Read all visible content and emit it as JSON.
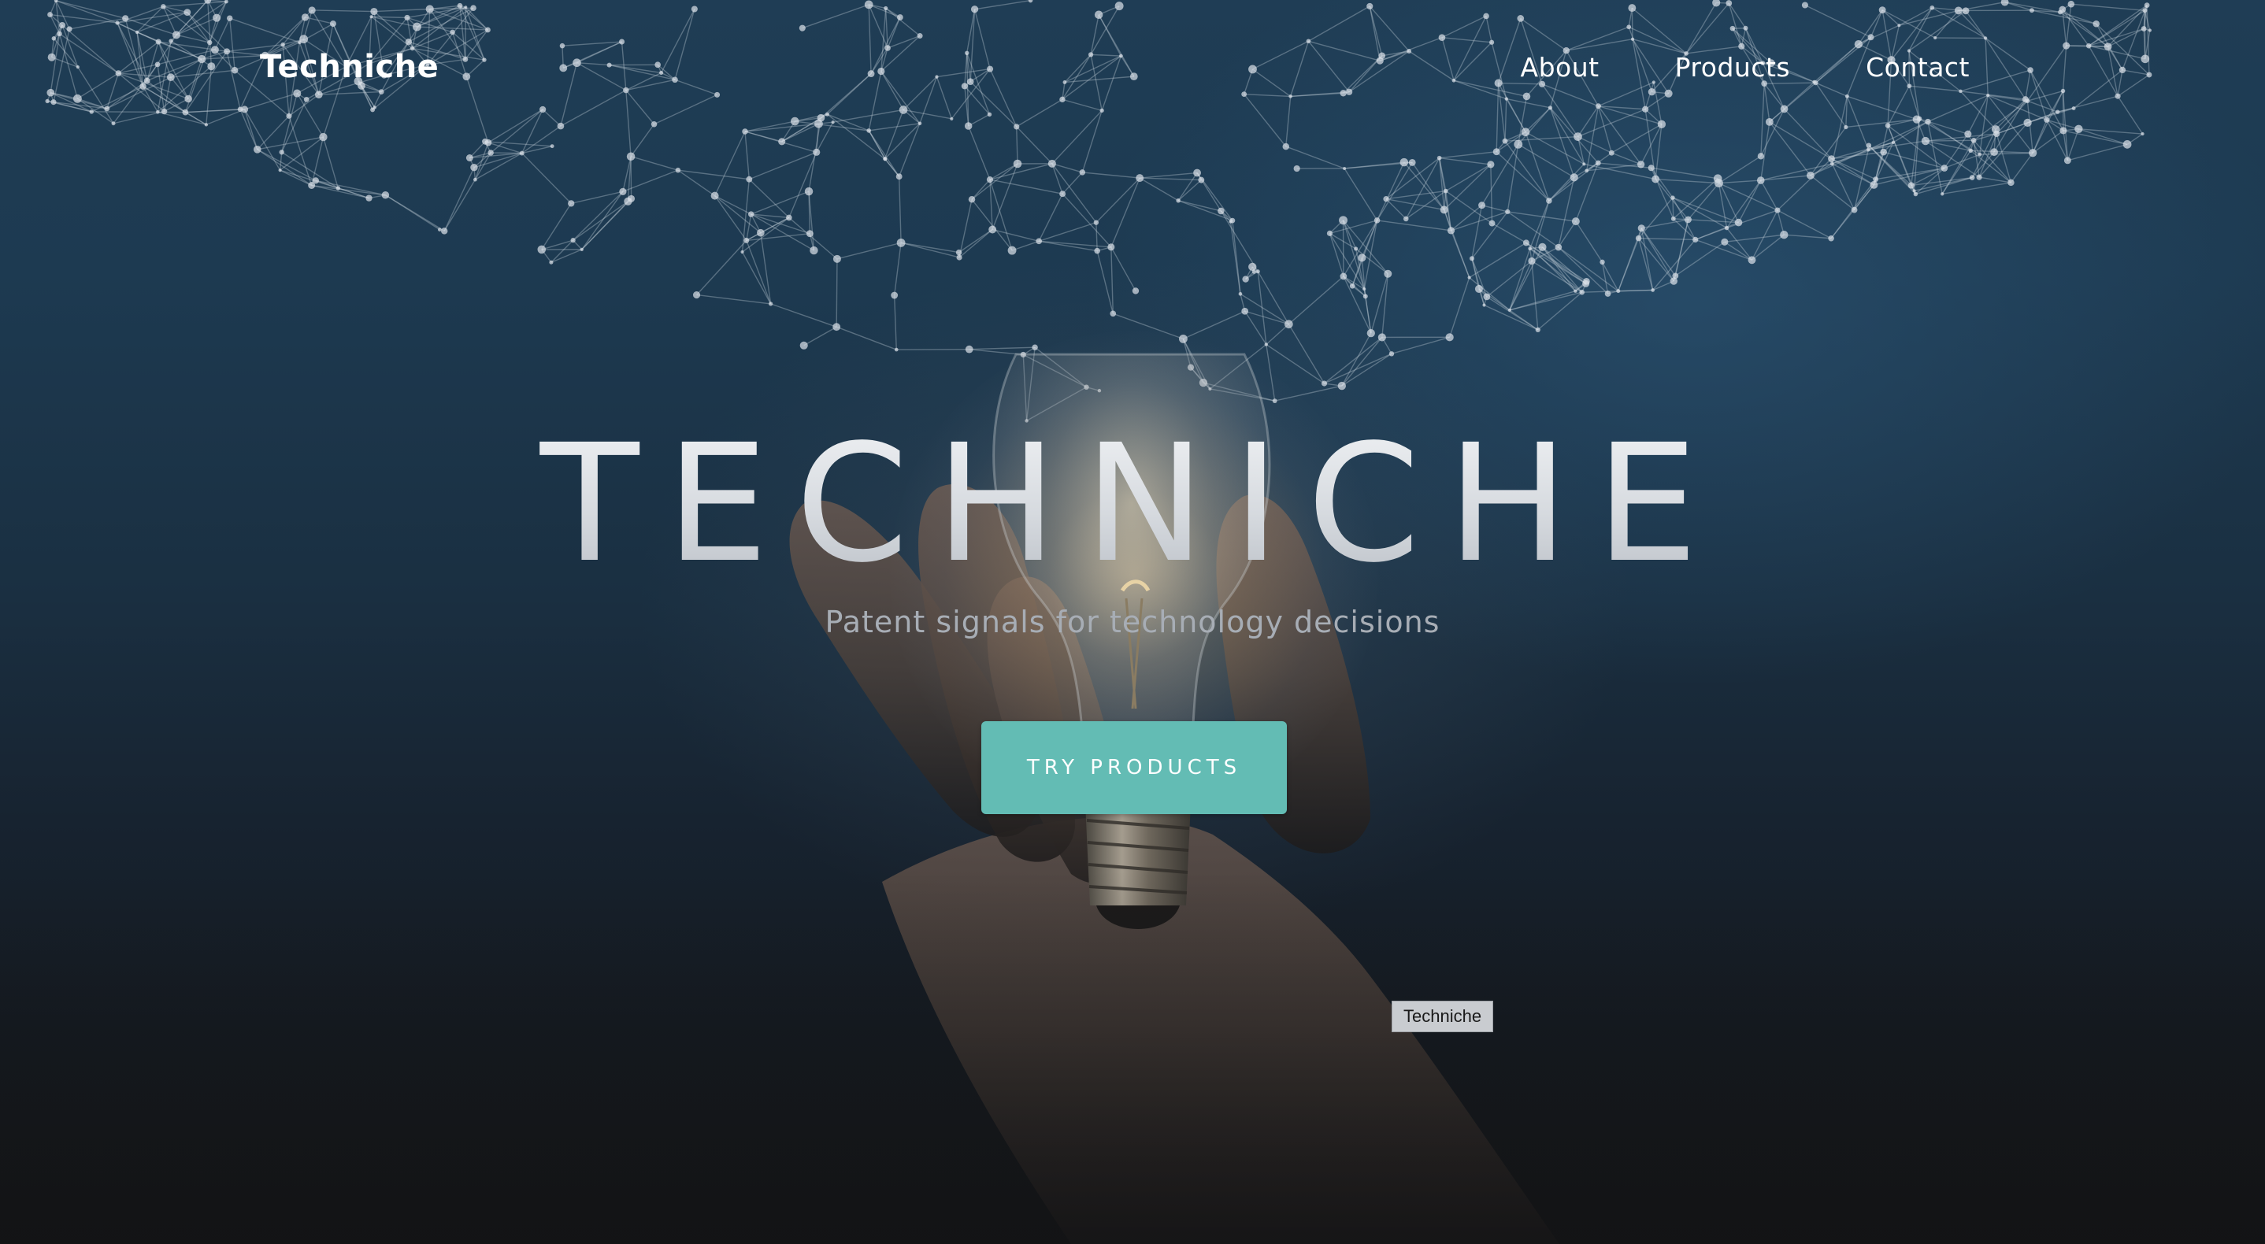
{
  "nav": {
    "brand": "Techniche",
    "links": [
      {
        "label": "About"
      },
      {
        "label": "Products"
      },
      {
        "label": "Contact"
      }
    ]
  },
  "hero": {
    "title": "TECHNICHE",
    "subtitle": "Patent signals for technology decisions",
    "cta_label": "TRY PRODUCTS",
    "background_image": "hand holding glowing light bulb with network constellation",
    "tooltip": "Techniche"
  },
  "colors": {
    "accent": "#63bcb4",
    "background_top": "#1f3d55",
    "background_bottom": "#141516",
    "text": "#ffffff"
  }
}
